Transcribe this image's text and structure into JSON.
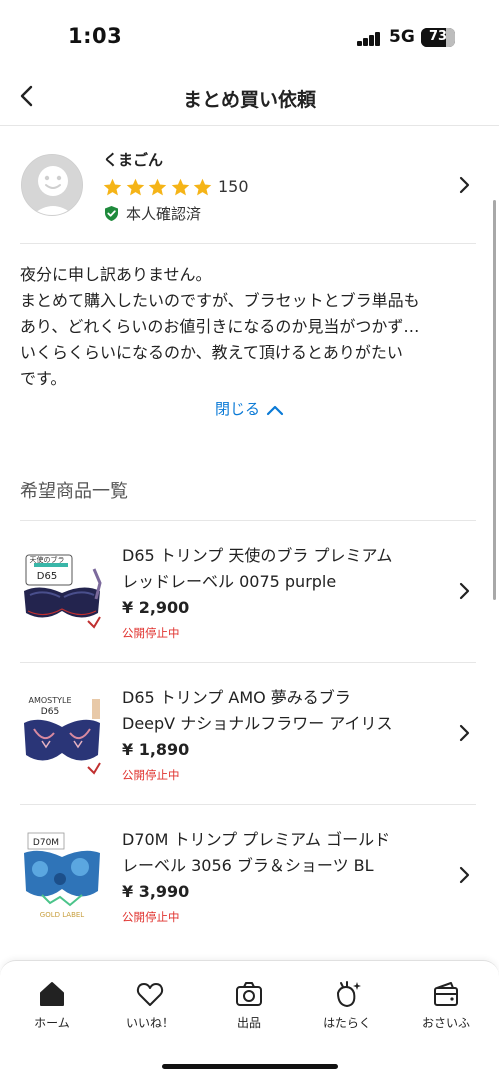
{
  "status_bar": {
    "time": "1:03",
    "network": "5G",
    "battery": "73",
    "battery_level": 0.73
  },
  "header": {
    "title": "まとめ買い依頼",
    "back_icon": "chevron-left-icon"
  },
  "seller": {
    "name": "くまごん",
    "rating_stars": 5,
    "rating_count": "150",
    "verified_label": "本人確認済",
    "star_color": "#f5b417",
    "verified_color": "#1f8a3c"
  },
  "message": {
    "lines": [
      "夜分に申し訳ありません。",
      "まとめて購入したいのですが、ブラセットとブラ単品も",
      "あり、どれくらいのお値引きになるのか見当がつかず…",
      "いくらくらいになるのか、教えて頂けるとありがたい",
      "です。"
    ],
    "collapse_label": "閉じる"
  },
  "section": {
    "title": "希望商品一覧"
  },
  "items": [
    {
      "title_line1": "D65 トリンプ 天使のブラ プレミアム",
      "title_line2": "レッドレーベル 0075 purple",
      "price": "¥ 2,900",
      "status": "公開停止中",
      "thumb_label": "D65",
      "thumb_tag": "天使のブラ"
    },
    {
      "title_line1": "D65 トリンプ AMO 夢みるブラ",
      "title_line2": "DeepV ナショナルフラワー アイリス",
      "price": "¥ 1,890",
      "status": "公開停止中",
      "thumb_label": "D65",
      "thumb_tag": "AMOSTYLE"
    },
    {
      "title_line1": "D70M トリンプ プレミアム ゴールド",
      "title_line2": "レーベル 3056 ブラ＆ショーツ BL",
      "price": "¥ 3,990",
      "status": "公開停止中",
      "thumb_label": "D70M",
      "thumb_tag": "GOLD LABEL"
    }
  ],
  "tab_bar": {
    "tabs": [
      {
        "label": "ホーム",
        "icon": "home-icon"
      },
      {
        "label": "いいね！",
        "icon": "heart-icon"
      },
      {
        "label": "出品",
        "icon": "camera-icon"
      },
      {
        "label": "はたらく",
        "icon": "sparkle-bag-icon"
      },
      {
        "label": "おさいふ",
        "icon": "wallet-icon"
      }
    ]
  }
}
